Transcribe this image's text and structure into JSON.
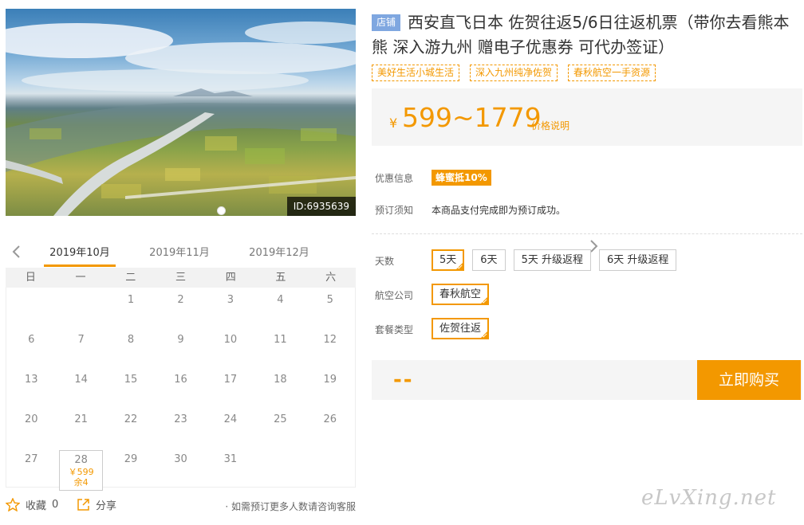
{
  "photo": {
    "id_label": "ID:6935639"
  },
  "calendar": {
    "months": [
      "2019年10月",
      "2019年11月",
      "2019年12月"
    ],
    "active_month": 0,
    "weekdays": [
      "日",
      "一",
      "二",
      "三",
      "四",
      "五",
      "六"
    ],
    "days": [
      "",
      "",
      "1",
      "2",
      "3",
      "4",
      "5",
      "6",
      "7",
      "8",
      "9",
      "10",
      "11",
      "12",
      "13",
      "14",
      "15",
      "16",
      "17",
      "18",
      "19",
      "20",
      "21",
      "22",
      "23",
      "24",
      "25",
      "26",
      "27",
      "28",
      "29",
      "30",
      "31",
      "",
      ""
    ],
    "selected_day": {
      "day": "28",
      "price": "￥599",
      "stock": "余4"
    }
  },
  "bottom": {
    "favorite_label": "收藏",
    "favorite_count": "0",
    "share_label": "分享",
    "consult_text": "· 如需预订更多人数请咨询客服"
  },
  "product": {
    "shop_tag": "店铺",
    "title": "西安直飞日本 佐贺往返5/6日往返机票（带你去看熊本熊 深入游九州 赠电子优惠券 可代办签证）",
    "tags": [
      "美好生活小城生活",
      "深入九州纯净佐贺",
      "春秋航空一手资源"
    ],
    "price_symbol": "¥",
    "price_range": "599~1779",
    "price_note": "价格说明"
  },
  "info": {
    "promo_label": "优惠信息",
    "promo_badge": "蜂蜜抵10%",
    "notice_label": "预订须知",
    "notice_text": "本商品支付完成即为预订成功。"
  },
  "options": {
    "days_label": "天数",
    "days": [
      "5天",
      "6天",
      "5天 升级返程",
      "6天 升级返程"
    ],
    "airline_label": "航空公司",
    "airlines": [
      "春秋航空"
    ],
    "package_label": "套餐类型",
    "packages": [
      "佐贺往返"
    ]
  },
  "buy": {
    "price_placeholder": "--",
    "button_label": "立即购买"
  },
  "watermark": "eLvXing.net",
  "colors": {
    "accent": "#f39800",
    "shop_tag": "#7fa7e0",
    "panel_bg": "#f5f5f5"
  }
}
